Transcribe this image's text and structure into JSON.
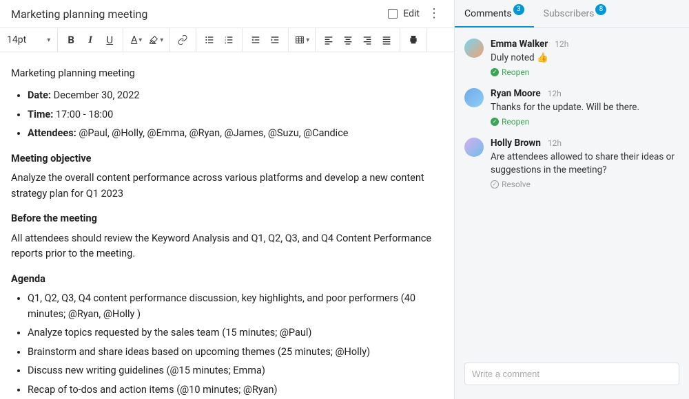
{
  "header": {
    "title": "Marketing planning meeting",
    "edit_label": "Edit"
  },
  "toolbar": {
    "font_size": "14pt"
  },
  "document": {
    "title_line": "Marketing planning meeting",
    "meta": {
      "date_label": "Date:",
      "date_value": " December 30, 2022",
      "time_label": "Time:",
      "time_value": " 17:00 - 18:00",
      "attendees_label": "Attendees:",
      "attendees_value": " @Paul, @Holly, @Emma, @Ryan, @James, @Suzu, @Candice"
    },
    "objective_heading": "Meeting objective",
    "objective_text": "Analyze the overall content performance across various platforms and develop a new content strategy plan for Q1 2023",
    "before_heading": "Before the meeting",
    "before_text": "All attendees should review the Keyword Analysis and Q1, Q2, Q3, and Q4 Content Performance reports prior to the meeting.",
    "agenda_heading": "Agenda",
    "agenda_items": [
      "Q1, Q2, Q3, Q4 content performance discussion, key highlights, and poor performers (40 minutes; @Ryan, @Holly )",
      "Analyze topics requested by the sales team (15 minutes; @Paul)",
      "Brainstorm and share ideas based on upcoming themes (25 minutes; @Holly)",
      "Discuss new writing guidelines (@15 minutes; Emma)",
      "Recap of to-dos and action items (@10 minutes; @Ryan)"
    ]
  },
  "side": {
    "tabs": {
      "comments_label": "Comments",
      "comments_count": "3",
      "subscribers_label": "Subscribers",
      "subscribers_count": "8"
    },
    "comments": [
      {
        "author": "Emma Walker",
        "time": "12h",
        "text": "Duly noted  👍",
        "status_label": "Reopen",
        "status_kind": "reopen"
      },
      {
        "author": "Ryan Moore",
        "time": "12h",
        "text": "Thanks for the update. Will be there.",
        "status_label": "Reopen",
        "status_kind": "reopen"
      },
      {
        "author": "Holly Brown",
        "time": "12h",
        "text": "Are attendees allowed to share their ideas or suggestions in the meeting?",
        "status_label": "Resolve",
        "status_kind": "resolve"
      }
    ],
    "input_placeholder": "Write a comment"
  }
}
